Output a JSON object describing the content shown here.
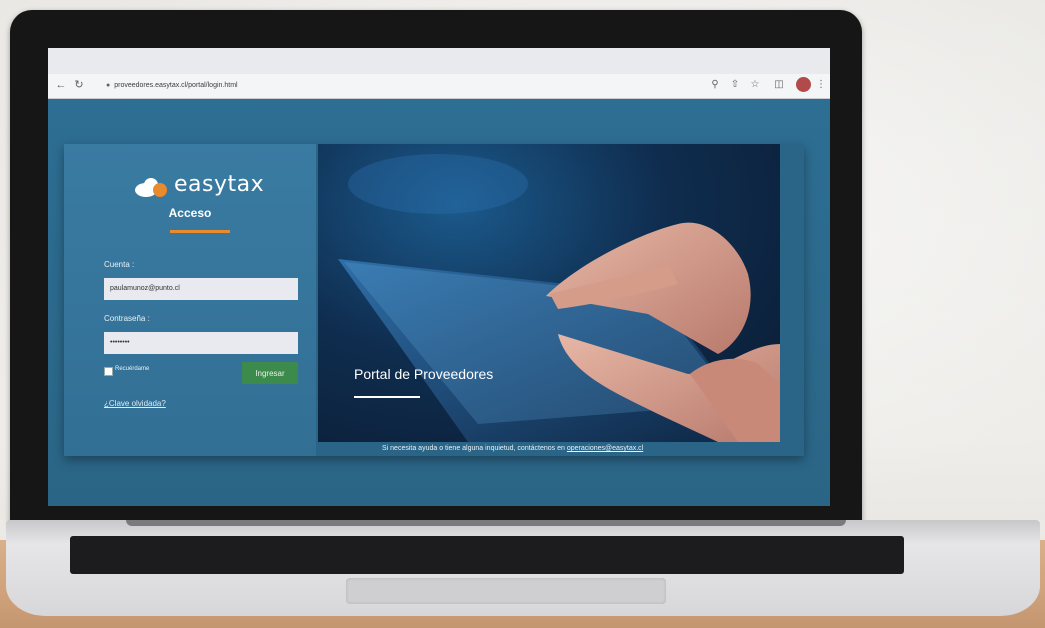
{
  "browser": {
    "url": "proveedores.easytax.cl/portal/login.html",
    "back_icon": "arrow-left-icon",
    "reload_icon": "reload-icon",
    "lock_icon": "lock-icon"
  },
  "login": {
    "logo_text": "easytax",
    "heading": "Acceso",
    "account_label": "Cuenta :",
    "account_value": "paulamunoz@punto.cl",
    "password_label": "Contraseña :",
    "password_value": "••••••••",
    "remember_label": "Recuérdame",
    "submit_label": "Ingresar",
    "forgot_link": "¿Clave olvidada?"
  },
  "hero": {
    "title": "Portal de Proveedores"
  },
  "footer": {
    "help_text": "Si necesita ayuda o tiene alguna inquietud, contáctenos en ",
    "help_email": "operaciones@easytax.cl"
  },
  "colors": {
    "accent": "#e98a2c",
    "button": "#3c8a4c",
    "page_bg": "#2d6e93"
  }
}
